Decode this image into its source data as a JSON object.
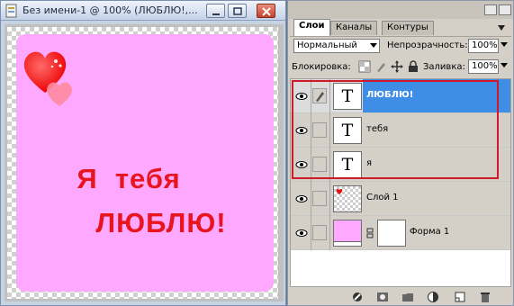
{
  "document_window": {
    "title": "Без имени-1 @ 100% (ЛЮБЛЮ!,..."
  },
  "canvas": {
    "line1": "Я  тебя",
    "line2": "ЛЮБЛЮ!",
    "text_color": "#e8141e",
    "background_color": "#ffa8ff"
  },
  "layers_panel": {
    "tabs": [
      "Слои",
      "Каналы",
      "Контуры"
    ],
    "active_tab": "Слои",
    "blend_mode": "Нормальный",
    "opacity_label": "Непрозрачность:",
    "opacity_value": "100%",
    "lock_label": "Блокировка:",
    "fill_label": "Заливка:",
    "fill_value": "100%",
    "layers": [
      {
        "name": "ЛЮБЛЮ!",
        "type": "text",
        "thumb": "T",
        "selected": true,
        "visible": true
      },
      {
        "name": "тебя",
        "type": "text",
        "thumb": "T",
        "selected": false,
        "visible": true
      },
      {
        "name": "я",
        "type": "text",
        "thumb": "T",
        "selected": false,
        "visible": true
      },
      {
        "name": "Слой 1",
        "type": "raster",
        "selected": false,
        "visible": true
      },
      {
        "name": "Форма 1",
        "type": "shape",
        "selected": false,
        "visible": true
      }
    ],
    "accent_color": "#3f8ee6",
    "highlight_frame_color": "#d01a2a"
  }
}
